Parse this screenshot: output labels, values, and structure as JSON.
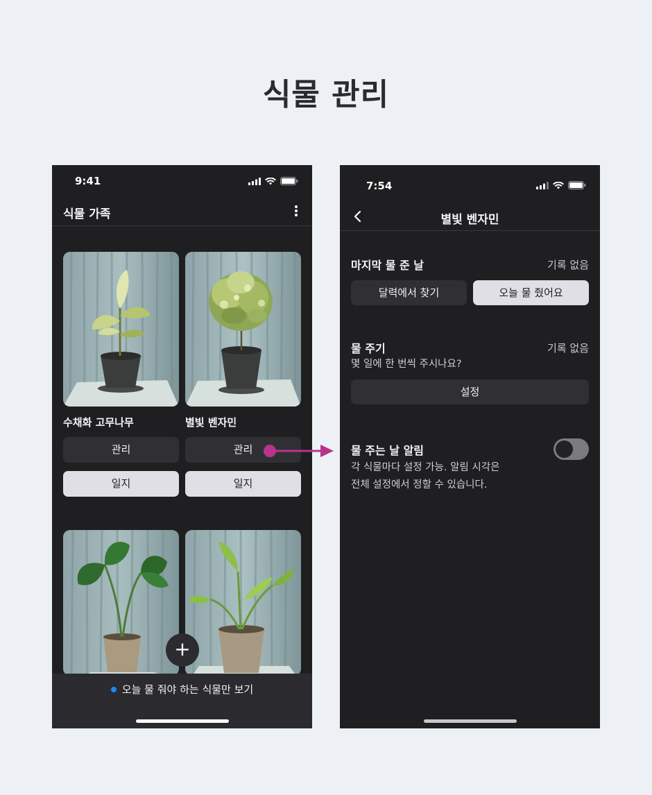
{
  "title": "식물 관리",
  "accent_color": "#b8338a",
  "left_screen": {
    "status_time": "9:41",
    "header_title": "식물 가족",
    "plants": [
      {
        "name": "수채화 고무나무",
        "manage_label": "관리",
        "journal_label": "일지"
      },
      {
        "name": "별빛 벤자민",
        "manage_label": "관리",
        "journal_label": "일지"
      }
    ],
    "add_button": "+",
    "filter_label": "오늘 물 줘야 하는 식물만 보기"
  },
  "right_screen": {
    "status_time": "7:54",
    "header_title": "별빛 벤자민",
    "last_watered": {
      "title": "마지막 물 준 날",
      "value": "기록 없음",
      "calendar_button": "달력에서 찾기",
      "today_button": "오늘 물 줬어요"
    },
    "watering_cycle": {
      "title": "물 주기",
      "value": "기록 없음",
      "question": "몇 일에 한 번씩 주시나요?",
      "set_button": "설정"
    },
    "reminder": {
      "title": "물 주는 날 알림",
      "description_line1": "각 식물마다 설정 가능. 알림 시각은",
      "description_line2": "전체 설정에서 정할 수 있습니다.",
      "enabled": false
    }
  }
}
